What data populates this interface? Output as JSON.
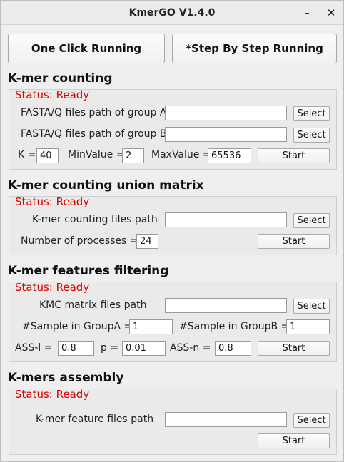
{
  "window": {
    "title": "KmerGO V1.4.0",
    "minimize_label": "–",
    "close_label": "✕"
  },
  "top_buttons": {
    "one_click": "One Click Running",
    "step_by_step": "*Step By Step Running"
  },
  "counting": {
    "title": "K-mer counting",
    "status": "Status: Ready",
    "group_a_label": "FASTA/Q files path of group A",
    "group_a_value": "",
    "group_b_label": "FASTA/Q files path of group B",
    "group_b_value": "",
    "select_label": "Select",
    "k_label": "K =",
    "k_value": "40",
    "min_label": "MinValue =",
    "min_value": "2",
    "max_label": "MaxValue =",
    "max_value": "65536",
    "start_label": "Start"
  },
  "union": {
    "title": "K-mer counting union matrix",
    "status": "Status: Ready",
    "files_label": "K-mer counting files path",
    "files_value": "",
    "select_label": "Select",
    "processes_label": "Number of processes =",
    "processes_value": "24",
    "start_label": "Start"
  },
  "filtering": {
    "title": "K-mer features filtering",
    "status": "Status: Ready",
    "kmc_label": "KMC matrix files path",
    "kmc_value": "",
    "select_label": "Select",
    "sample_a_label": "#Sample in GroupA =",
    "sample_a_value": "1",
    "sample_b_label": "#Sample in GroupB =",
    "sample_b_value": "1",
    "ass_l_label": "ASS-l =",
    "ass_l_value": "0.8",
    "p_label": "p =",
    "p_value": "0.01",
    "ass_n_label": "ASS-n =",
    "ass_n_value": "0.8",
    "start_label": "Start"
  },
  "assembly": {
    "title": "K-mers assembly",
    "status": "Status: Ready",
    "files_label": "K-mer feature files path",
    "files_value": "",
    "select_label": "Select",
    "start_label": "Start"
  }
}
